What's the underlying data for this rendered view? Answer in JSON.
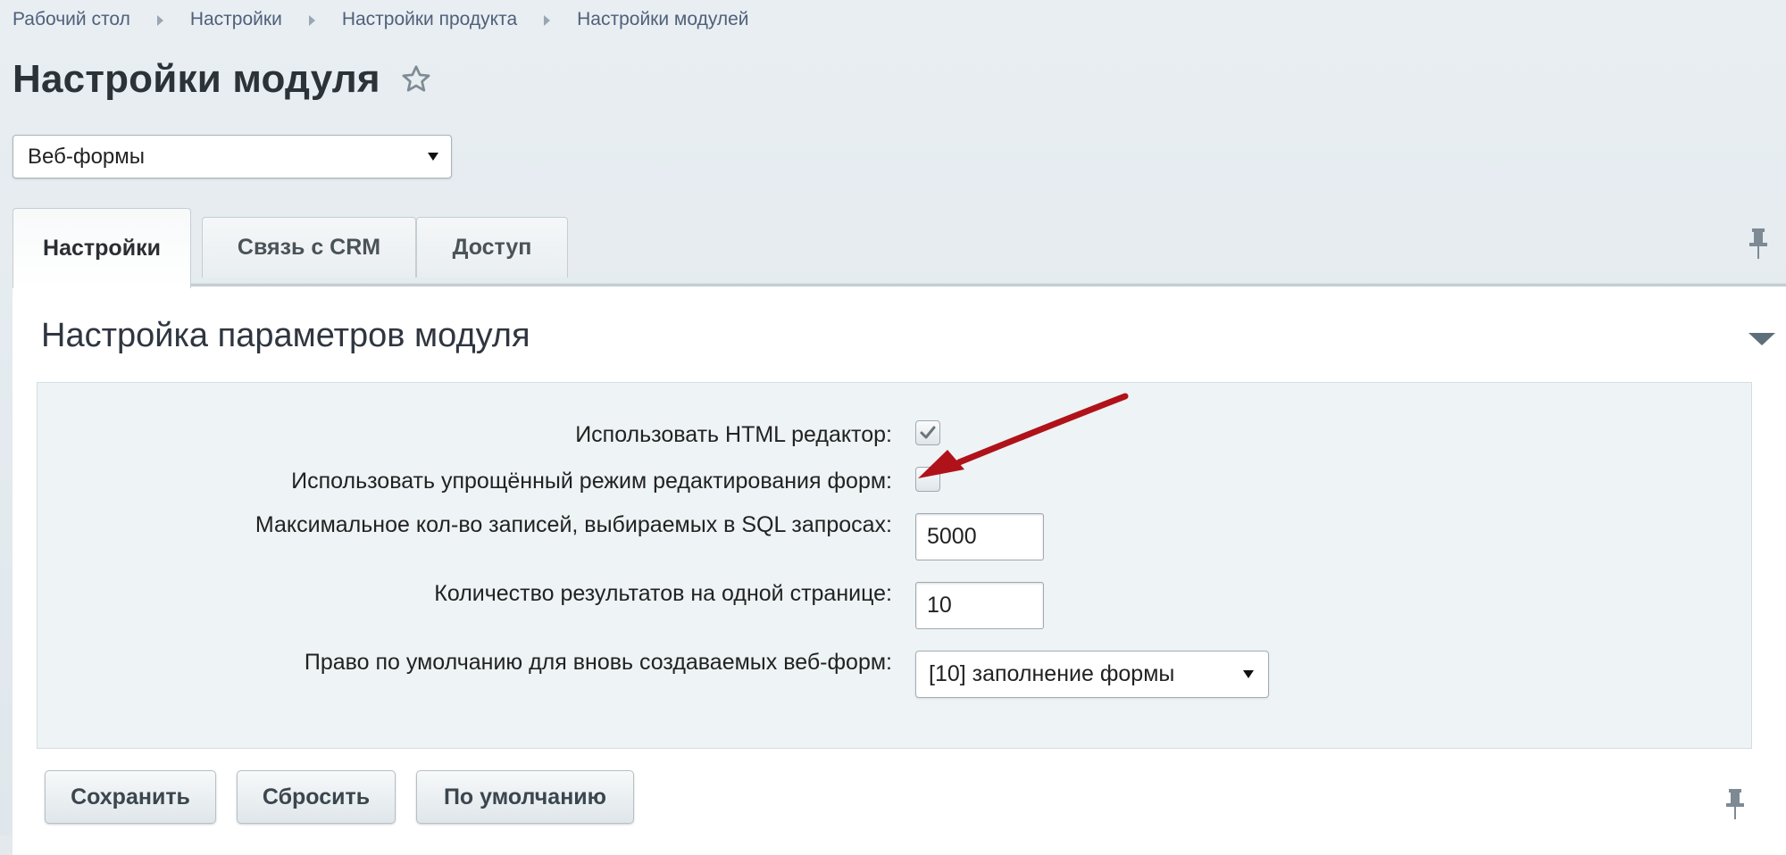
{
  "breadcrumb": [
    {
      "label": "Рабочий стол"
    },
    {
      "label": "Настройки"
    },
    {
      "label": "Настройки продукта"
    },
    {
      "label": "Настройки модулей"
    }
  ],
  "page": {
    "title": "Настройки модуля",
    "star_icon": "star-icon"
  },
  "module_select": {
    "value": "Веб-формы"
  },
  "tabs": [
    {
      "label": "Настройки",
      "active": true
    },
    {
      "label": "Связь с CRM",
      "active": false
    },
    {
      "label": "Доступ",
      "active": false
    }
  ],
  "section": {
    "title": "Настройка параметров модуля"
  },
  "settings": {
    "use_html_editor": {
      "label": "Использовать HTML редактор:",
      "checked": true
    },
    "simple_mode": {
      "label": "Использовать упрощённый режим редактирования форм:",
      "checked": false
    },
    "max_records": {
      "label": "Максимальное кол-во записей, выбираемых в SQL запросах:",
      "value": "5000"
    },
    "results_per_page": {
      "label": "Количество результатов на одной странице:",
      "value": "10"
    },
    "default_right": {
      "label": "Право по умолчанию для вновь создаваемых веб-форм:",
      "value": "[10] заполнение формы"
    }
  },
  "buttons": {
    "save": "Сохранить",
    "reset": "Сбросить",
    "default": "По умолчанию"
  },
  "colors": {
    "background": "#e3e9ed",
    "panel": "#ffffff",
    "settings_box": "#eef3f5",
    "annotation_arrow": "#b0121a",
    "breadcrumb_text": "#50607a"
  }
}
